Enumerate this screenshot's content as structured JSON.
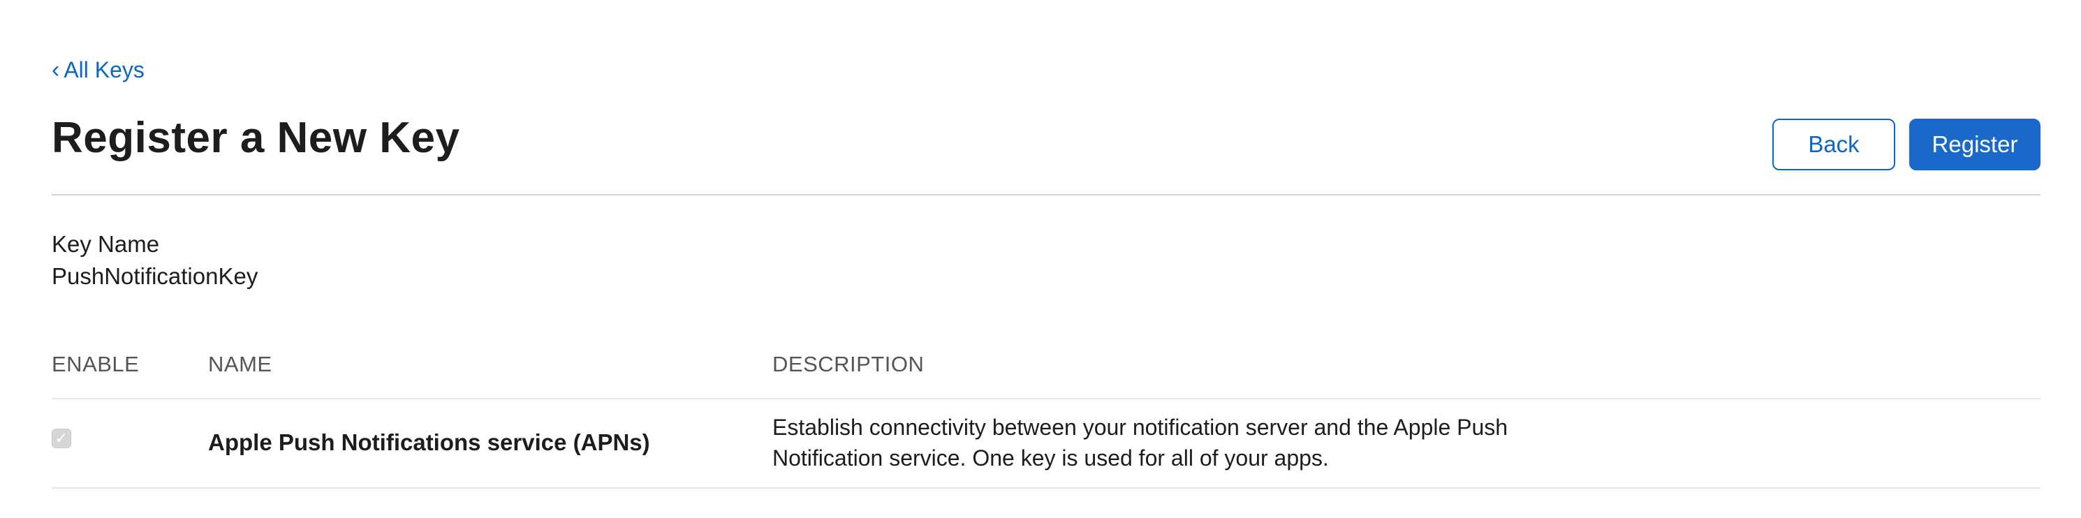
{
  "nav": {
    "back_link_chevron": "‹",
    "back_link_label": "All Keys"
  },
  "header": {
    "title": "Register a New Key",
    "back_button_label": "Back",
    "register_button_label": "Register"
  },
  "key_name": {
    "label": "Key Name",
    "value": "PushNotificationKey"
  },
  "table": {
    "headers": {
      "enable": "ENABLE",
      "name": "NAME",
      "description": "DESCRIPTION"
    },
    "rows": [
      {
        "enabled": true,
        "checkbox_disabled": true,
        "checkmark": "✓",
        "name": "Apple Push Notifications service (APNs)",
        "description_line1": "Establish connectivity between your notification server and the Apple Push",
        "description_line2": "Notification service. One key is used for all of your apps."
      }
    ]
  },
  "colors": {
    "accent": "#0a66c8",
    "primary_button": "#1a68c9",
    "divider": "#d2d2d7",
    "text": "#1d1d1f"
  }
}
